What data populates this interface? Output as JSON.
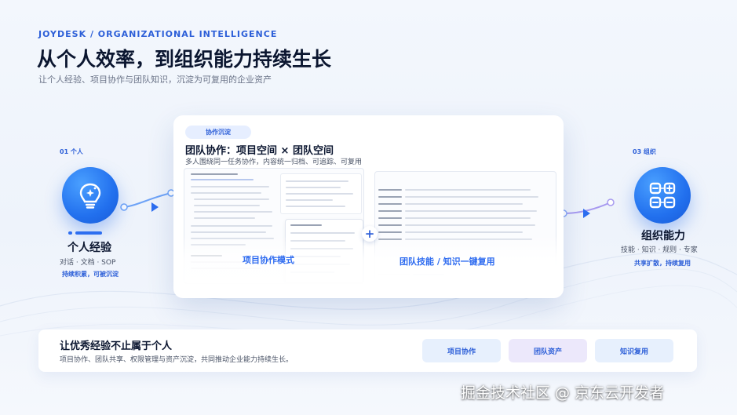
{
  "header": {
    "eyebrow": "JOYDESK / ORGANIZATIONAL INTELLIGENCE",
    "title": "从个人效率，到组织能力持续生长",
    "subtitle": "让个人经验、项目协作与团队知识，沉淀为可复用的企业资产"
  },
  "left_stage": {
    "step": "01 个人",
    "title": "个人经验",
    "desc": "对话 · 文档 · SOP",
    "note": "持续积累，可被沉淀",
    "icon": "lightbulb-icon"
  },
  "right_stage": {
    "step": "03 组织",
    "title": "组织能力",
    "desc": "技能 · 知识 · 规则 · 专家",
    "note": "共享扩散，持续复用",
    "icon": "grid-nodes-icon"
  },
  "center": {
    "tag": "协作沉淀",
    "title": "团队协作：项目空间 × 团队空间",
    "subtitle": "多人围绕同一任务协作，内容统一归档、可追踪、可复用",
    "left_caption": "项目协作模式",
    "right_caption": "团队技能 / 知识一键复用",
    "plus": "+"
  },
  "bottom": {
    "title": "让优秀经验不止属于个人",
    "desc": "项目协作、团队共享、权限管理与资产沉淀，共同推动企业能力持续生长。",
    "chips": [
      "项目协作",
      "团队资产",
      "知识复用"
    ]
  },
  "watermark": "掘金技术社区 @ 京东云开发者",
  "colors": {
    "accent": "#2d5fd8",
    "primary_circle": "#2270ee",
    "background": "#f3f7fd"
  }
}
